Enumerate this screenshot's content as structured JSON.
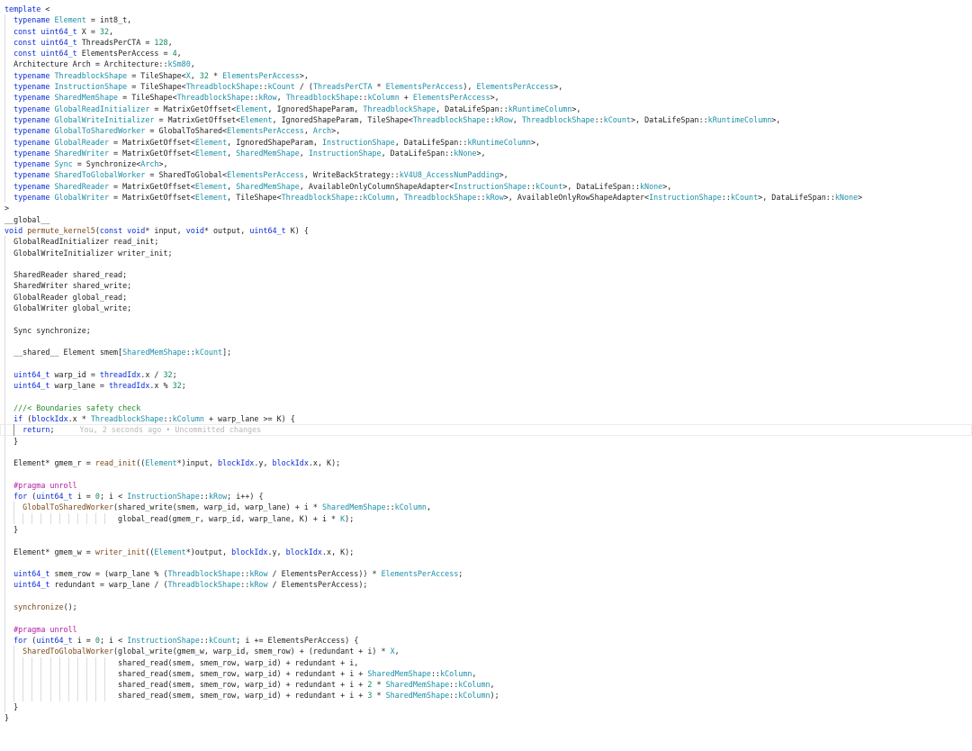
{
  "editor": {
    "blame_annotation": "You, 2 seconds ago • Uncommitted changes",
    "lines": [
      "template <",
      "  typename Element = int8_t,",
      "  const uint64_t X = 32,",
      "  const uint64_t ThreadsPerCTA = 128,",
      "  const uint64_t ElementsPerAccess = 4,",
      "  Architecture Arch = Architecture::kSm80,",
      "  typename ThreadblockShape = TileShape<X, 32 * ElementsPerAccess>,",
      "  typename InstructionShape = TileShape<ThreadblockShape::kCount / (ThreadsPerCTA * ElementsPerAccess), ElementsPerAccess>,",
      "  typename SharedMemShape = TileShape<ThreadblockShape::kRow, ThreadblockShape::kColumn + ElementsPerAccess>,",
      "  typename GlobalReadInitializer = MatrixGetOffset<Element, IgnoredShapeParam, ThreadblockShape, DataLifeSpan::kRuntimeColumn>,",
      "  typename GlobalWriteInitializer = MatrixGetOffset<Element, IgnoredShapeParam, TileShape<ThreadblockShape::kRow, ThreadblockShape::kCount>, DataLifeSpan::kRuntimeColumn>,",
      "  typename GlobalToSharedWorker = GlobalToShared<ElementsPerAccess, Arch>,",
      "  typename GlobalReader = MatrixGetOffset<Element, IgnoredShapeParam, InstructionShape, DataLifeSpan::kRuntimeColumn>,",
      "  typename SharedWriter = MatrixGetOffset<Element, SharedMemShape, InstructionShape, DataLifeSpan::kNone>,",
      "  typename Sync = Synchronize<Arch>,",
      "  typename SharedToGlobalWorker = SharedToGlobal<ElementsPerAccess, WriteBackStrategy::kV4U8_AccessNumPadding>,",
      "  typename SharedReader = MatrixGetOffset<Element, SharedMemShape, AvailableOnlyColumnShapeAdapter<InstructionShape::kCount>, DataLifeSpan::kNone>,",
      "  typename GlobalWriter = MatrixGetOffset<Element, TileShape<ThreadblockShape::kColumn, ThreadblockShape::kRow>, AvailableOnlyRowShapeAdapter<InstructionShape::kCount>, DataLifeSpan::kNone>",
      ">",
      "__global__",
      "void permute_kernel5(const void* input, void* output, uint64_t K) {",
      "  GlobalReadInitializer read_init;",
      "  GlobalWriteInitializer writer_init;",
      "",
      "  SharedReader shared_read;",
      "  SharedWriter shared_write;",
      "  GlobalReader global_read;",
      "  GlobalWriter global_write;",
      "",
      "  Sync synchronize;",
      "",
      "  __shared__ Element smem[SharedMemShape::kCount];",
      "",
      "  uint64_t warp_id = threadIdx.x / 32;",
      "  uint64_t warp_lane = threadIdx.x % 32;",
      "",
      "  ///< Boundaries safety check",
      "  if (blockIdx.x * ThreadblockShape::kColumn + warp_lane >= K) {",
      "    return;",
      "  }",
      "",
      "  Element* gmem_r = read_init((Element*)input, blockIdx.y, blockIdx.x, K);",
      "",
      "  #pragma unroll",
      "  for (uint64_t i = 0; i < InstructionShape::kRow; i++) {",
      "    GlobalToSharedWorker(shared_write(smem, warp_id, warp_lane) + i * SharedMemShape::kColumn,",
      "                         global_read(gmem_r, warp_id, warp_lane, K) + i * K);",
      "  }",
      "",
      "  Element* gmem_w = writer_init((Element*)output, blockIdx.y, blockIdx.x, K);",
      "",
      "  uint64_t smem_row = (warp_lane % (ThreadblockShape::kRow / ElementsPerAccess)) * ElementsPerAccess;",
      "  uint64_t redundant = warp_lane / (ThreadblockShape::kRow / ElementsPerAccess);",
      "",
      "  synchronize();",
      "",
      "  #pragma unroll",
      "  for (uint64_t i = 0; i < InstructionShape::kCount; i += ElementsPerAccess) {",
      "    SharedToGlobalWorker(global_write(gmem_w, warp_id, smem_row) + (redundant + i) * X,",
      "                         shared_read(smem, smem_row, warp_id) + redundant + i,",
      "                         shared_read(smem, smem_row, warp_id) + redundant + i + SharedMemShape::kColumn,",
      "                         shared_read(smem, smem_row, warp_id) + redundant + i + 2 * SharedMemShape::kColumn,",
      "                         shared_read(smem, smem_row, warp_id) + redundant + i + 3 * SharedMemShape::kColumn);",
      "  }",
      "}"
    ]
  }
}
